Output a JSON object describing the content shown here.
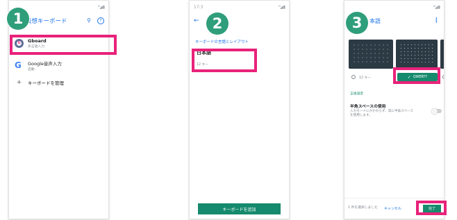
{
  "colors": {
    "accent": "#1a73e8",
    "highlight": "#e8227a",
    "badge": "#2f9e7a",
    "teal": "#168a6d"
  },
  "badges": [
    "1",
    "2",
    "3"
  ],
  "p1": {
    "signal": "ᴹ◢ ▮",
    "title": "仮想キーボード",
    "items": [
      {
        "icon": "gboard-icon",
        "label": "Gboard",
        "sub": "多言語入力"
      },
      {
        "icon": "google-g-icon",
        "label": "Google音声入力",
        "sub": "自動"
      },
      {
        "icon": "plus-icon",
        "label": "キーボードを管理",
        "sub": ""
      }
    ]
  },
  "p2": {
    "time": "17:3",
    "signal": "ᴹ◢ ▮",
    "section_label": "キーボードの言語とレイアウト",
    "language": "日本語",
    "layout": "12 キー",
    "add_button": "キーボードを追加"
  },
  "p3": {
    "signal": "ᴹ◢ ▮",
    "title": "本語",
    "options": [
      {
        "label": "12 キー",
        "selected": false
      },
      {
        "label": "QWERTY",
        "selected": true
      }
    ],
    "section_label": "言語設定",
    "setting_title": "半角スペースの使用",
    "setting_desc": "入力モードにかかわらず、常に半角スペースを使用します。",
    "footer_count": "1 件を選択しました",
    "cancel": "キャンセル",
    "done": "完了"
  }
}
